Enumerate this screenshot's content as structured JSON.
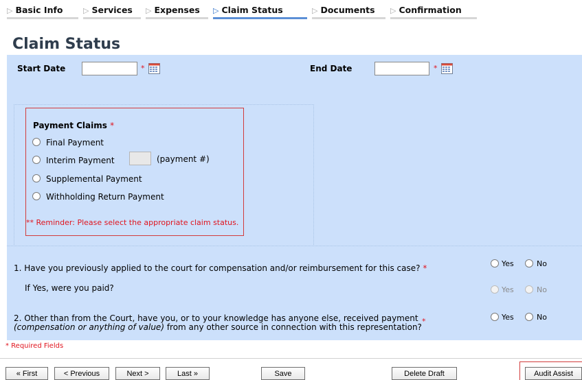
{
  "tabs": [
    {
      "label": "Basic Info"
    },
    {
      "label": "Services"
    },
    {
      "label": "Expenses"
    },
    {
      "label": "Claim Status"
    },
    {
      "label": "Documents"
    },
    {
      "label": "Confirmation"
    }
  ],
  "active_tab": "Claim Status",
  "page_title": "Claim Status",
  "dates": {
    "start_label": "Start Date",
    "start_value": "",
    "end_label": "End Date",
    "end_value": "",
    "required_mark": "*"
  },
  "payment_claims": {
    "heading": "Payment Claims",
    "required_mark": "*",
    "options": [
      {
        "label": "Final Payment",
        "selected": false
      },
      {
        "label": "Interim Payment",
        "selected": false
      },
      {
        "label": "Supplemental Payment",
        "selected": false
      },
      {
        "label": "Withholding Return Payment",
        "selected": false
      }
    ],
    "payment_num_value": "",
    "payment_num_label": "(payment #)",
    "reminder": "** Reminder: Please select the appropriate claim status."
  },
  "questions": {
    "q1": "1. Have you previously applied to the court for compensation and/or reimbursement for this case?",
    "q1_required": "*",
    "q1_sub": "If Yes, were you paid?",
    "q2_line1": "2. Other than from the Court, have you, or to your knowledge has anyone else, received payment",
    "q2_line2_italic": "(compensation or anything of value)",
    "q2_line2_rest": " from any other source in connection with this representation?",
    "q2_required": "*",
    "yes": "Yes",
    "no": "No"
  },
  "required_fields_note": "* Required Fields",
  "buttons": {
    "first": "« First",
    "previous": "< Previous",
    "next": "Next >",
    "last": "Last »",
    "save": "Save",
    "delete_draft": "Delete Draft",
    "audit_assist": "Audit Assist"
  },
  "colors": {
    "panel_bg": "#cce0fb",
    "required_red": "#e0141e",
    "active_tab_underline": "#5b8fd6",
    "title_color": "#2f3d4d"
  },
  "icons": {
    "tab_separator": "chevron-right-icon",
    "date_picker": "calendar-icon"
  }
}
